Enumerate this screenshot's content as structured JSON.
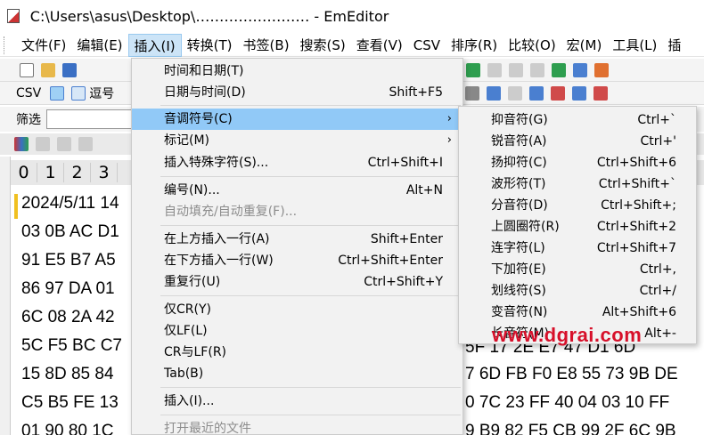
{
  "window": {
    "title": "C:\\Users\\asus\\Desktop\\(...)  - EmEditor",
    "title_shown": "C:\\Users\\asus\\Desktop\\…………………… - EmEditor"
  },
  "menubar": {
    "items": [
      "文件(F)",
      "编辑(E)",
      "插入(I)",
      "转换(T)",
      "书签(B)",
      "搜索(S)",
      "查看(V)",
      "CSV",
      "排序(R)",
      "比较(O)",
      "宏(M)",
      "工具(L)",
      "插"
    ]
  },
  "toolbar2": {
    "csv_label": "CSV",
    "comma_label": "逗号"
  },
  "filterbar": {
    "label": "筛选",
    "value": ""
  },
  "ruler": {
    "cols": [
      "0",
      "1",
      "2",
      "3"
    ]
  },
  "editor": {
    "lines": [
      "2024/5/11 14",
      "03 0B AC D1",
      "91 E5 B7 A5",
      "86 97 DA 01",
      "6C 08 2A 42",
      "5C F5 BC C7",
      "15 8D 85 84",
      "C5 B5 FE 13",
      "01 90 80 1C"
    ],
    "right_lines": [
      "5F 17 2E E7 47 D1 6D",
      "7 6D FB F0 E8 55 73 9B DE",
      "0 7C 23 FF 40 04 03 10 FF",
      "9 B9 82 F5 CB 99 2F 6C 9B"
    ]
  },
  "insert_menu": {
    "items": [
      {
        "label": "时间和日期(T)",
        "shortcut": ""
      },
      {
        "label": "日期与时间(D)",
        "shortcut": "Shift+F5"
      },
      {
        "label": "音调符号(C)",
        "shortcut": "",
        "submenu": true,
        "highlighted": true
      },
      {
        "label": "标记(M)",
        "shortcut": "",
        "submenu": true
      },
      {
        "label": "插入特殊字符(S)...",
        "shortcut": "Ctrl+Shift+I"
      },
      {
        "label": "编号(N)...",
        "shortcut": "Alt+N"
      },
      {
        "label": "自动填充/自动重复(F)...",
        "shortcut": "",
        "disabled": true
      },
      {
        "label": "在上方插入一行(A)",
        "shortcut": "Shift+Enter"
      },
      {
        "label": "在下方插入一行(W)",
        "shortcut": "Ctrl+Shift+Enter"
      },
      {
        "label": "重复行(U)",
        "shortcut": "Ctrl+Shift+Y"
      },
      {
        "label": "仅CR(Y)",
        "shortcut": ""
      },
      {
        "label": "仅LF(L)",
        "shortcut": ""
      },
      {
        "label": "CR与LF(R)",
        "shortcut": ""
      },
      {
        "label": "Tab(B)",
        "shortcut": ""
      },
      {
        "label": "插入(I)...",
        "shortcut": ""
      },
      {
        "label": "打开最近的文件",
        "shortcut": "",
        "disabled": true
      }
    ]
  },
  "diacritics_menu": {
    "items": [
      {
        "label": "抑音符(G)",
        "shortcut": "Ctrl+`"
      },
      {
        "label": "锐音符(A)",
        "shortcut": "Ctrl+'"
      },
      {
        "label": "扬抑符(C)",
        "shortcut": "Ctrl+Shift+6"
      },
      {
        "label": "波形符(T)",
        "shortcut": "Ctrl+Shift+`"
      },
      {
        "label": "分音符(D)",
        "shortcut": "Ctrl+Shift+;"
      },
      {
        "label": "上圆圈符(R)",
        "shortcut": "Ctrl+Shift+2"
      },
      {
        "label": "连字符(L)",
        "shortcut": "Ctrl+Shift+7"
      },
      {
        "label": "下加符(E)",
        "shortcut": "Ctrl+,"
      },
      {
        "label": "划线符(S)",
        "shortcut": "Ctrl+/"
      },
      {
        "label": "变音符(N)",
        "shortcut": "Alt+Shift+6"
      },
      {
        "label": "长音符(M)",
        "shortcut": "Alt+-"
      }
    ]
  },
  "watermark": "www.dgrai.com",
  "colors": {
    "highlight": "#91c9f7",
    "menubar_active": "#cce4f7",
    "watermark": "#d7102a",
    "line_mark": "#f0c020"
  }
}
